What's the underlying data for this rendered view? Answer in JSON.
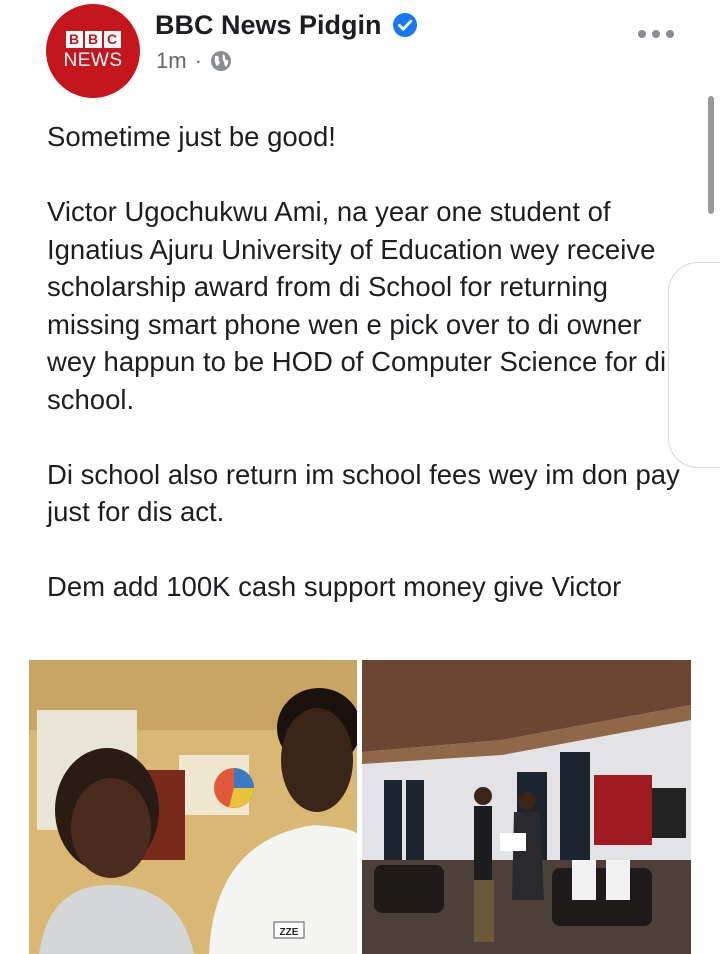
{
  "post": {
    "page_name": "BBC News Pidgin",
    "time": "1m",
    "separator": "·",
    "avatar": {
      "logo_blocks": [
        "B",
        "B",
        "C"
      ],
      "logo_word": "NEWS"
    },
    "paragraphs": [
      "Sometime just be good!",
      "Victor Ugochukwu Ami, na year one student of Ignatius Ajuru University of Education wey receive scholarship award from di School for returning missing smart phone wen e pick over to di owner wey happun to be HOD of Computer Science for di school.",
      "Di school also return im school fees wey im don pay just for dis act.",
      "Dem add 100K cash support money give Victor"
    ],
    "photos": {
      "left_shirt_text": "ZZE"
    }
  },
  "icons": {
    "verified": "verified-badge-icon",
    "audience": "globe-icon",
    "menu": "more-options-icon"
  },
  "colors": {
    "brand_red": "#c4161c",
    "verified_blue": "#1877f2",
    "text": "#1c1e21",
    "secondary_text": "#65676b"
  }
}
